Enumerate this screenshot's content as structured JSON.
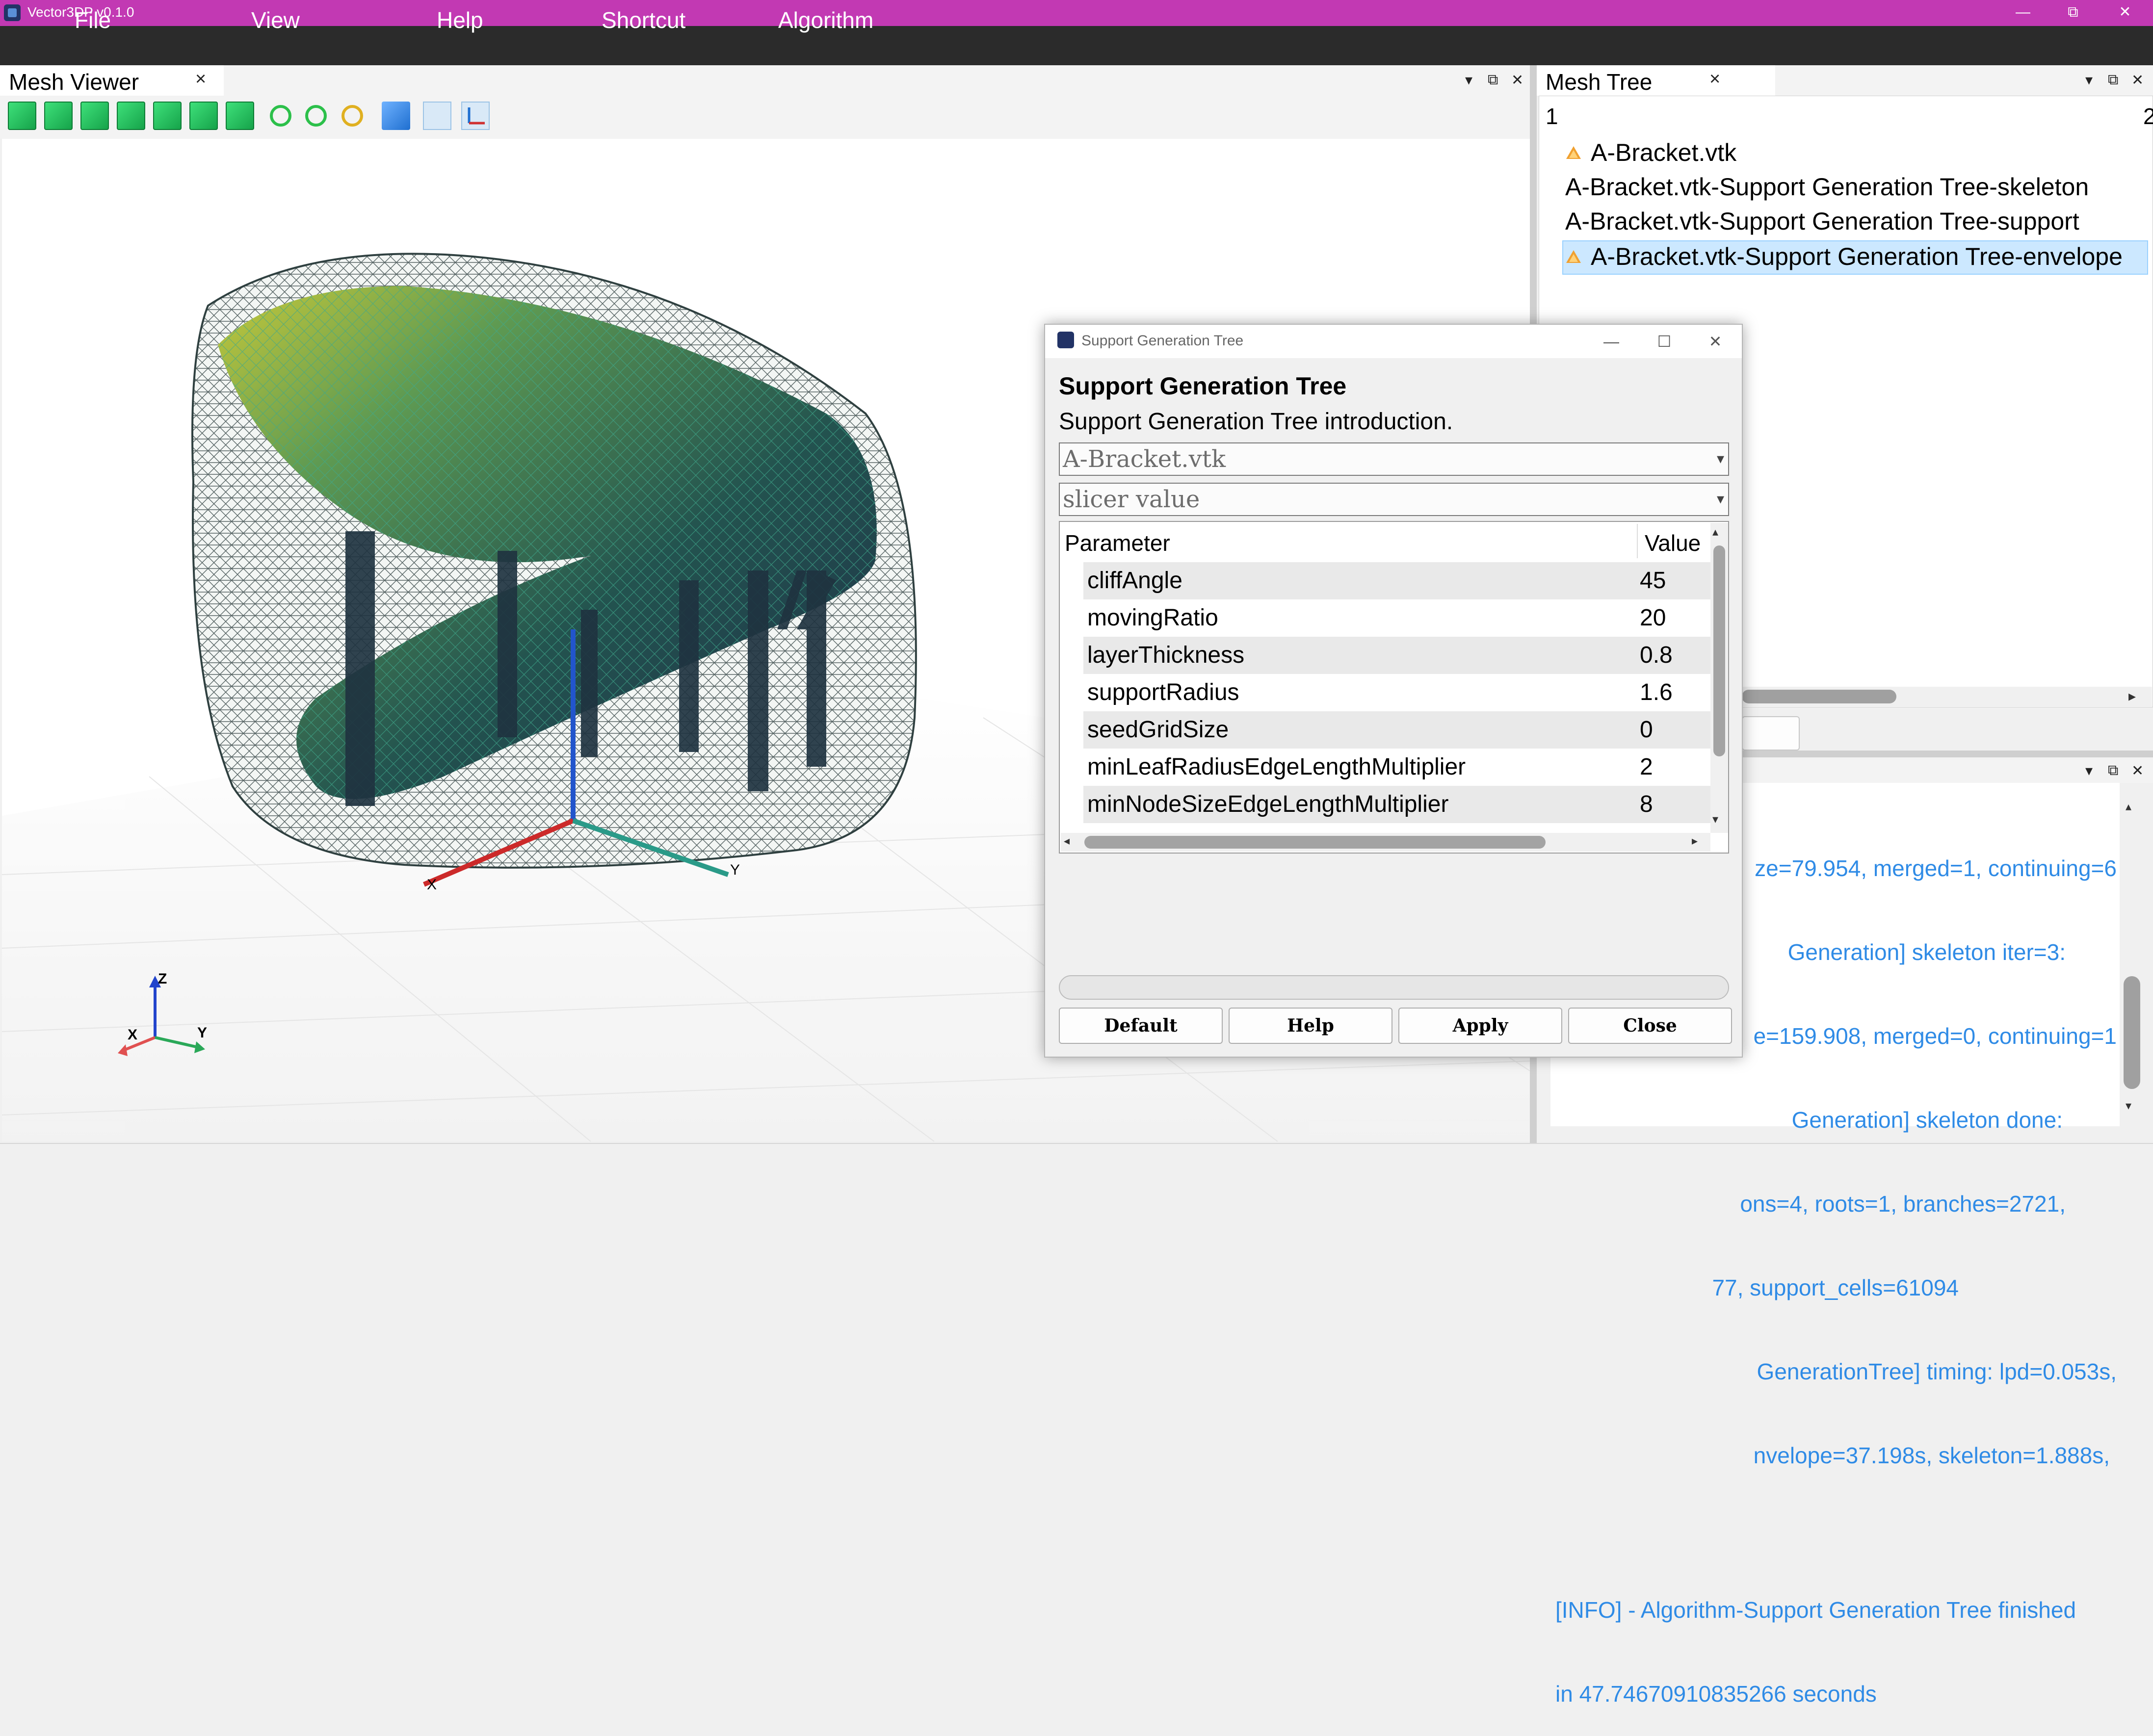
{
  "window": {
    "title": "Vector3DP v0.1.0",
    "controls": [
      "—",
      "⧉",
      "✕"
    ]
  },
  "menu": [
    "File",
    "View",
    "Help",
    "Shortcut",
    "Algorithm"
  ],
  "mesh_viewer": {
    "tab_label": "Mesh Viewer",
    "close_glyph": "×",
    "dock_controls": [
      "▾",
      "⧉",
      "✕"
    ],
    "toolbar_icons": [
      "view-front-icon",
      "view-back-icon",
      "view-left-icon",
      "view-right-icon",
      "view-top-icon",
      "view-bottom-icon",
      "view-iso-icon",
      "zoom-in-icon",
      "zoom-out-icon",
      "zoom-fit-icon",
      "cube-icon",
      "clip-plane-icon",
      "axes-icon"
    ],
    "scene_axes": {
      "x": "X",
      "y": "Y"
    },
    "orientation_axes": {
      "x": "X",
      "y": "Y",
      "z": "Z"
    }
  },
  "mesh_tree": {
    "tab_label": "Mesh Tree",
    "close_glyph": "×",
    "dock_controls": [
      "▾",
      "⧉",
      "✕"
    ],
    "header_col1": "1",
    "header_col2": "2",
    "items": [
      {
        "label": "A-Bracket.vtk",
        "icon": true
      },
      {
        "label": "A-Bracket.vtk-Support Generation Tree-skeleton",
        "icon": false
      },
      {
        "label": "A-Bracket.vtk-Support Generation Tree-support",
        "icon": false
      },
      {
        "label": "A-Bracket.vtk-Support Generation Tree-envelope",
        "icon": true,
        "selected": true
      }
    ]
  },
  "log": {
    "dock_controls": [
      "▾",
      "⧉",
      "✕"
    ],
    "lines": [
      "ze=79.954, merged=1, continuing=6",
      "Generation] skeleton iter=3:",
      "e=159.908, merged=0, continuing=1",
      "Generation] skeleton done:",
      "ons=4, roots=1, branches=2721,",
      "77, support_cells=61094",
      "GenerationTree] timing: lpd=0.053s,",
      "nvelope=37.198s, skeleton=1.888s,",
      "",
      "[INFO] - Algorithm-Support Generation Tree finished",
      "in 47.74670910835266 seconds"
    ]
  },
  "dialog": {
    "title": "Support Generation Tree",
    "controls": [
      "—",
      "☐",
      "✕"
    ],
    "heading": "Support Generation Tree",
    "intro": "Support Generation Tree introduction.",
    "mesh_select": "A-Bracket.vtk",
    "slicer_select": "slicer value",
    "table": {
      "headers": {
        "param": "Parameter",
        "value": "Value"
      },
      "rows": [
        {
          "name": "cliffAngle",
          "value": "45"
        },
        {
          "name": "movingRatio",
          "value": "20"
        },
        {
          "name": "layerThickness",
          "value": "0.8"
        },
        {
          "name": "supportRadius",
          "value": "1.6"
        },
        {
          "name": "seedGridSize",
          "value": "0"
        },
        {
          "name": "minLeafRadiusEdgeLengthMultiplier",
          "value": "2"
        },
        {
          "name": "minNodeSizeEdgeLengthMultiplier",
          "value": "8"
        }
      ]
    },
    "buttons": {
      "default": "Default",
      "help": "Help",
      "apply": "Apply",
      "close": "Close"
    }
  },
  "colors": {
    "titlebar": "#c239b3",
    "menubar": "#2b2b2b",
    "log_text": "#2f8be6",
    "selection": "#cce8ff"
  }
}
